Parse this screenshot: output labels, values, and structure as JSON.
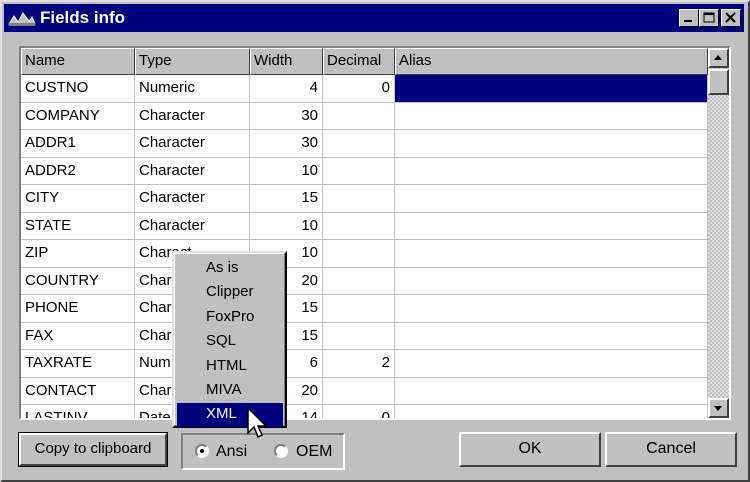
{
  "window": {
    "title": "Fields info"
  },
  "columns": [
    "Name",
    "Type",
    "Width",
    "Decimal",
    "Alias"
  ],
  "rows": [
    {
      "name": "CUSTNO",
      "type": "Numeric",
      "width": "4",
      "decimal": "0",
      "alias": "",
      "selected": true
    },
    {
      "name": "COMPANY",
      "type": "Character",
      "width": "30",
      "decimal": "",
      "alias": ""
    },
    {
      "name": "ADDR1",
      "type": "Character",
      "width": "30",
      "decimal": "",
      "alias": ""
    },
    {
      "name": "ADDR2",
      "type": "Character",
      "width": "10",
      "decimal": "",
      "alias": ""
    },
    {
      "name": "CITY",
      "type": "Character",
      "width": "15",
      "decimal": "",
      "alias": ""
    },
    {
      "name": "STATE",
      "type": "Character",
      "width": "10",
      "decimal": "",
      "alias": ""
    },
    {
      "name": "ZIP",
      "type": "Charact",
      "width": "10",
      "decimal": "",
      "alias": ""
    },
    {
      "name": "COUNTRY",
      "type": "Char",
      "width": "20",
      "decimal": "",
      "alias": ""
    },
    {
      "name": "PHONE",
      "type": "Char",
      "width": "15",
      "decimal": "",
      "alias": ""
    },
    {
      "name": "FAX",
      "type": "Char",
      "width": "15",
      "decimal": "",
      "alias": ""
    },
    {
      "name": "TAXRATE",
      "type": "Num",
      "width": "6",
      "decimal": "2",
      "alias": ""
    },
    {
      "name": "CONTACT",
      "type": "Char",
      "width": "20",
      "decimal": "",
      "alias": ""
    },
    {
      "name": "LASTINV",
      "type": "Date",
      "width": "14",
      "decimal": "0",
      "alias": ""
    }
  ],
  "context_menu": {
    "items": [
      "As is",
      "Clipper",
      "FoxPro",
      "SQL",
      "HTML",
      "MIVA",
      "XML"
    ],
    "highlighted": "XML"
  },
  "buttons": {
    "copy": "Copy to clipboard",
    "ok": "OK",
    "cancel": "Cancel"
  },
  "encoding": {
    "options": [
      "Ansi",
      "OEM"
    ],
    "selected": "Ansi"
  },
  "colors": {
    "selection": "#010180",
    "face": "#c0c0c0"
  }
}
